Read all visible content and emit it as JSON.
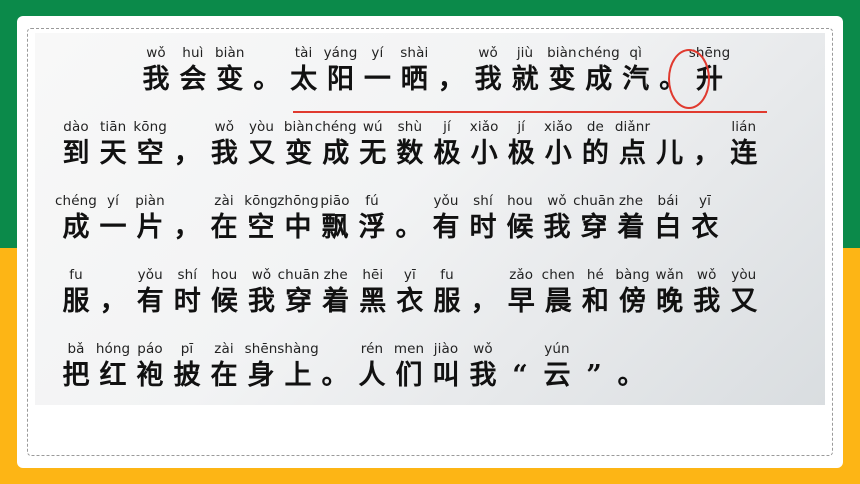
{
  "lines": [
    {
      "cells": [
        {
          "py": "wǒ",
          "hz": "我"
        },
        {
          "py": "huì",
          "hz": "会"
        },
        {
          "py": "biàn",
          "hz": "变"
        },
        {
          "py": "",
          "hz": "。"
        },
        {
          "py": "tài",
          "hz": "太"
        },
        {
          "py": "yáng",
          "hz": "阳"
        },
        {
          "py": "yí",
          "hz": "一"
        },
        {
          "py": "shài",
          "hz": "晒"
        },
        {
          "py": "",
          "hz": "，"
        },
        {
          "py": "wǒ",
          "hz": "我"
        },
        {
          "py": "jiù",
          "hz": "就"
        },
        {
          "py": "biàn",
          "hz": "变"
        },
        {
          "py": "chéng",
          "hz": "成"
        },
        {
          "py": "qì",
          "hz": "汽"
        },
        {
          "py": "",
          "hz": "。"
        },
        {
          "py": "shēng",
          "hz": "升"
        }
      ]
    },
    {
      "cells": [
        {
          "py": "dào",
          "hz": "到"
        },
        {
          "py": "tiān",
          "hz": "天"
        },
        {
          "py": "kōng",
          "hz": "空"
        },
        {
          "py": "",
          "hz": "，"
        },
        {
          "py": "wǒ",
          "hz": "我"
        },
        {
          "py": "yòu",
          "hz": "又"
        },
        {
          "py": "biàn",
          "hz": "变"
        },
        {
          "py": "chéng",
          "hz": "成"
        },
        {
          "py": "wú",
          "hz": "无"
        },
        {
          "py": "shù",
          "hz": "数"
        },
        {
          "py": "jí",
          "hz": "极"
        },
        {
          "py": "xiǎo",
          "hz": "小"
        },
        {
          "py": "jí",
          "hz": "极"
        },
        {
          "py": "xiǎo",
          "hz": "小"
        },
        {
          "py": "de",
          "hz": "的"
        },
        {
          "py": "diǎnr",
          "hz": "点"
        },
        {
          "py": "",
          "hz": "儿"
        },
        {
          "py": "",
          "hz": "，"
        },
        {
          "py": "lián",
          "hz": "连"
        }
      ]
    },
    {
      "cells": [
        {
          "py": "chéng",
          "hz": "成"
        },
        {
          "py": "yí",
          "hz": "一"
        },
        {
          "py": "piàn",
          "hz": "片"
        },
        {
          "py": "",
          "hz": "，"
        },
        {
          "py": "zài",
          "hz": "在"
        },
        {
          "py": "kōng",
          "hz": "空"
        },
        {
          "py": "zhōng",
          "hz": "中"
        },
        {
          "py": "piāo",
          "hz": "飘"
        },
        {
          "py": "fú",
          "hz": "浮"
        },
        {
          "py": "",
          "hz": "。"
        },
        {
          "py": "yǒu",
          "hz": "有"
        },
        {
          "py": "shí",
          "hz": "时"
        },
        {
          "py": "hou",
          "hz": "候"
        },
        {
          "py": "wǒ",
          "hz": "我"
        },
        {
          "py": "chuān",
          "hz": "穿"
        },
        {
          "py": "zhe",
          "hz": "着"
        },
        {
          "py": "bái",
          "hz": "白"
        },
        {
          "py": "yī",
          "hz": "衣"
        }
      ]
    },
    {
      "cells": [
        {
          "py": "fu",
          "hz": "服"
        },
        {
          "py": "",
          "hz": "，"
        },
        {
          "py": "yǒu",
          "hz": "有"
        },
        {
          "py": "shí",
          "hz": "时"
        },
        {
          "py": "hou",
          "hz": "候"
        },
        {
          "py": "wǒ",
          "hz": "我"
        },
        {
          "py": "chuān",
          "hz": "穿"
        },
        {
          "py": "zhe",
          "hz": "着"
        },
        {
          "py": "hēi",
          "hz": "黑"
        },
        {
          "py": "yī",
          "hz": "衣"
        },
        {
          "py": "fu",
          "hz": "服"
        },
        {
          "py": "",
          "hz": "，"
        },
        {
          "py": "zǎo",
          "hz": "早"
        },
        {
          "py": "chen",
          "hz": "晨"
        },
        {
          "py": "hé",
          "hz": "和"
        },
        {
          "py": "bàng",
          "hz": "傍"
        },
        {
          "py": "wǎn",
          "hz": "晚"
        },
        {
          "py": "wǒ",
          "hz": "我"
        },
        {
          "py": "yòu",
          "hz": "又"
        }
      ]
    },
    {
      "cells": [
        {
          "py": "bǎ",
          "hz": "把"
        },
        {
          "py": "hóng",
          "hz": "红"
        },
        {
          "py": "páo",
          "hz": "袍"
        },
        {
          "py": "pī",
          "hz": "披"
        },
        {
          "py": "zài",
          "hz": "在"
        },
        {
          "py": "shēn",
          "hz": "身"
        },
        {
          "py": "shàng",
          "hz": "上"
        },
        {
          "py": "",
          "hz": "。"
        },
        {
          "py": "rén",
          "hz": "人"
        },
        {
          "py": "men",
          "hz": "们"
        },
        {
          "py": "jiào",
          "hz": "叫"
        },
        {
          "py": "wǒ",
          "hz": "我"
        },
        {
          "py": "",
          "hz": "“"
        },
        {
          "py": "yún",
          "hz": "云"
        },
        {
          "py": "",
          "hz": "”"
        },
        {
          "py": "",
          "hz": "。"
        }
      ]
    }
  ],
  "colors": {
    "green": "#0b8a4a",
    "yellow": "#fdb515",
    "annotation": "#e03a2f"
  }
}
